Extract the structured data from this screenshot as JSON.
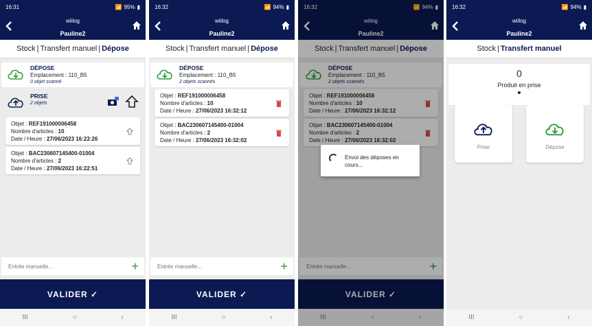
{
  "colors": {
    "navy": "#0b1a52",
    "green": "#2e9b3a",
    "red": "#d34a4a"
  },
  "header": {
    "logo": "wiilog",
    "user": "Pauline2"
  },
  "tabs": {
    "stock": "Stock",
    "transfert": "Transfert manuel",
    "depose": "Dépose",
    "sep": "|"
  },
  "screens": [
    {
      "status": {
        "time": "16:31",
        "battery": "95%"
      },
      "depose": {
        "title": "DÉPOSE",
        "location": "Emplacement : 110_B5",
        "sub": "0 objet scanné"
      },
      "prise": {
        "title": "PRISE",
        "sub": "2 objets"
      },
      "items": [
        {
          "obj_label": "Objet : ",
          "obj": "REF191000006458",
          "nb_label": "Nombre d'articles : ",
          "nb": "10",
          "dt_label": "Date / Heure : ",
          "dt": "27/06/2023 16:23:26"
        },
        {
          "obj_label": "Objet : ",
          "obj": "BAC230607145400-01004",
          "nb_label": "Nombre d'articles : ",
          "nb": "2",
          "dt_label": "Date / Heure : ",
          "dt": "27/06/2023 16:22:51"
        }
      ]
    },
    {
      "status": {
        "time": "16:32",
        "battery": "94%"
      },
      "depose": {
        "title": "DÉPOSE",
        "location": "Emplacement : 110_B5",
        "sub": "2 objets scannés"
      },
      "items": [
        {
          "obj_label": "Objet : ",
          "obj": "REF191000006458",
          "nb_label": "Nombre d'articles : ",
          "nb": "10",
          "dt_label": "Date / Heure : ",
          "dt": "27/06/2023 16:32:12"
        },
        {
          "obj_label": "Objet : ",
          "obj": "BAC230607145400-01004",
          "nb_label": "Nombre d'articles : ",
          "nb": "2",
          "dt_label": "Date / Heure : ",
          "dt": "27/06/2023 16:32:02"
        }
      ]
    },
    {
      "status": {
        "time": "16:32",
        "battery": "94%"
      },
      "dialog": "Envoi des déposes en cours..."
    },
    {
      "status": {
        "time": "16:32",
        "battery": "94%"
      },
      "counter": {
        "value": "0",
        "label": "Produit en prise"
      },
      "tiles": {
        "prise": "Prise",
        "depose": "Dépose"
      }
    }
  ],
  "manual": {
    "placeholder": "Entrée manuelle..."
  },
  "valider": "VALIDER ✓",
  "navbar": {
    "recent": "III",
    "home": "○",
    "back": "‹"
  }
}
